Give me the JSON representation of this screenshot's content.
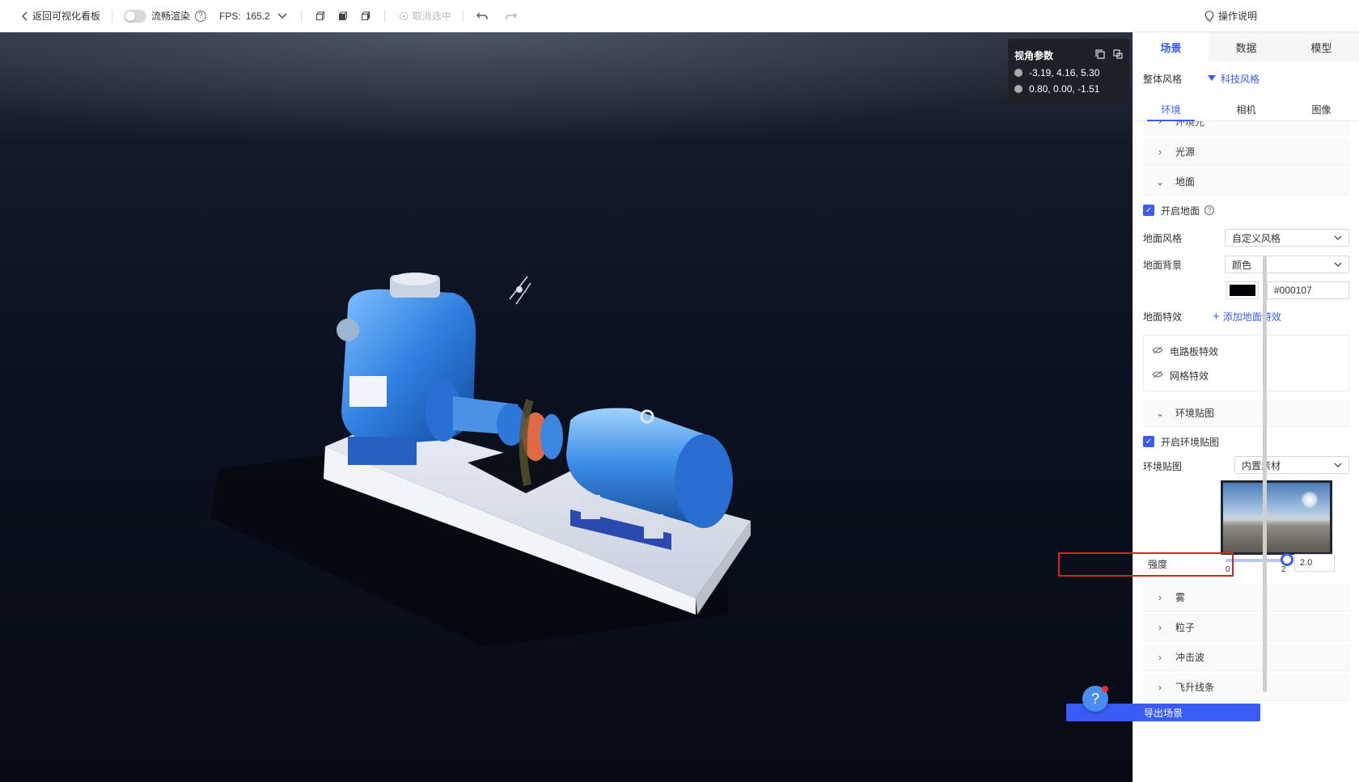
{
  "toolbar": {
    "back_label": "返回可视化看板",
    "smooth_label": "流畅渲染",
    "fps_label": "FPS:",
    "fps_value": "165.2",
    "deselect_label": "取消选中",
    "help_label": "操作说明"
  },
  "camera": {
    "title": "视角参数",
    "position": "-3.19, 4.16, 5.30",
    "target": "0.80, 0.00, -1.51"
  },
  "panel": {
    "tabs": [
      "场景",
      "数据",
      "模型"
    ],
    "style_label": "整体风格",
    "style_value": "科技风格",
    "sub_tabs": [
      "环境",
      "相机",
      "图像"
    ],
    "sections": {
      "env_light": "环境光",
      "light_source": "光源",
      "ground": "地面",
      "env_map": "环境贴图",
      "fog": "雾",
      "particles": "粒子",
      "shockwave": "冲击波",
      "flying_lines": "飞升线条"
    },
    "ground": {
      "enable_label": "开启地面",
      "style_label": "地面风格",
      "style_value": "自定义风格",
      "bg_label": "地面背景",
      "bg_value": "颜色",
      "color_hex": "#000107",
      "effects_label": "地面特效",
      "add_effect": "添加地面特效",
      "effects": [
        "电路板特效",
        "网格特效"
      ]
    },
    "envmap": {
      "enable_label": "开启环境贴图",
      "map_label": "环境贴图",
      "map_value": "内置素材",
      "intensity_label": "强度",
      "slider_min": "0",
      "slider_max": "2",
      "slider_value": "2.0"
    },
    "export_label": "导出场景"
  }
}
